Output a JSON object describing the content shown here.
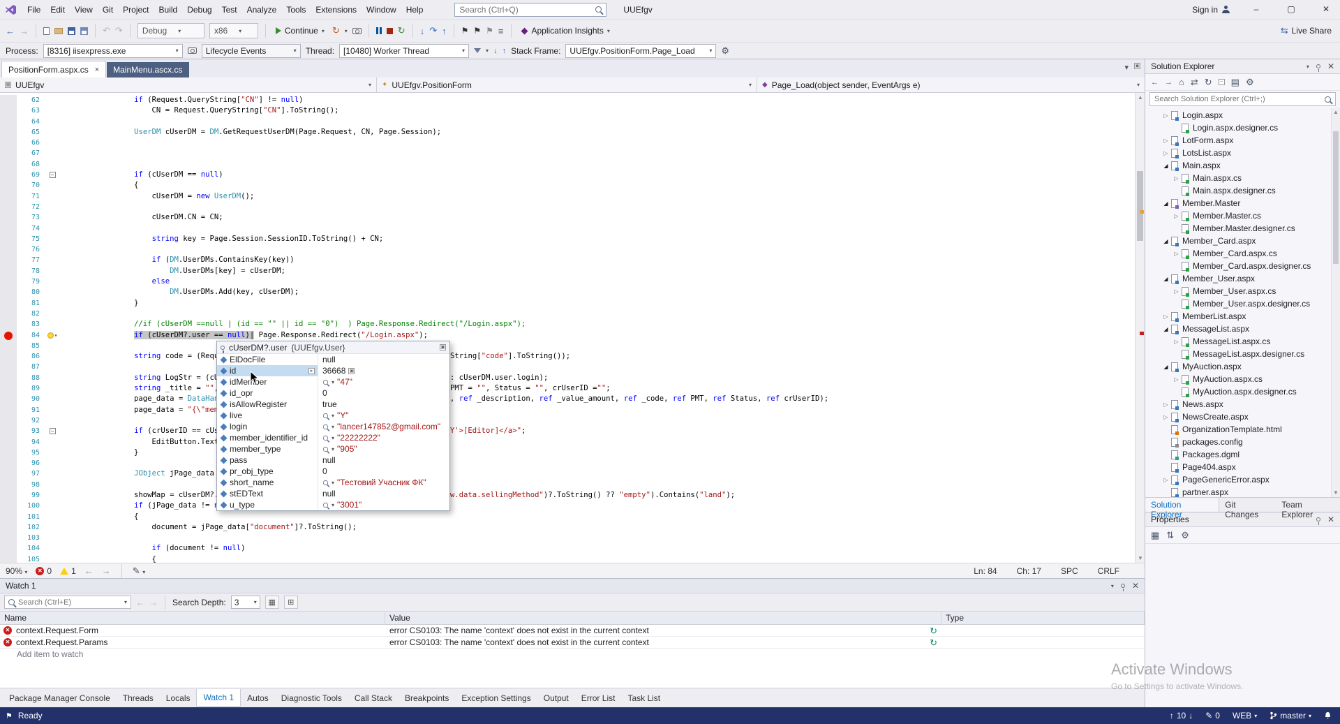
{
  "menu": {
    "items": [
      "File",
      "Edit",
      "View",
      "Git",
      "Project",
      "Build",
      "Debug",
      "Test",
      "Analyze",
      "Tools",
      "Extensions",
      "Window",
      "Help"
    ],
    "search_placeholder": "Search (Ctrl+Q)",
    "solution_name": "UUEfgv",
    "sign_in": "Sign in",
    "window_buttons": {
      "minimize": "–",
      "maximize": "▢",
      "close": "✕"
    }
  },
  "toolbar": {
    "debug_config": "Debug",
    "platform": "x86",
    "continue_label": "Continue",
    "app_insights_label": "Application Insights",
    "live_share_label": "Live Share"
  },
  "debug_location": {
    "process_label": "Process:",
    "process_value": "[8316] iisexpress.exe",
    "lifecycle_label": "Lifecycle Events",
    "thread_label": "Thread:",
    "thread_value": "[10480] Worker Thread",
    "stack_frame_label": "Stack Frame:",
    "stack_frame_value": "UUEfgv.PositionForm.Page_Load"
  },
  "editor": {
    "tabs": [
      {
        "label": "PositionForm.aspx.cs",
        "active": true
      },
      {
        "label": "MainMenu.ascx.cs",
        "active": false
      }
    ],
    "navbar": {
      "project": "UUEfgv",
      "type": "UUEfgv.PositionForm",
      "member": "Page_Load(object sender, EventArgs e)"
    },
    "first_line_number": 62,
    "breakpoint_line": 84,
    "bulb_line": 84,
    "fold_lines": [
      69,
      93
    ],
    "lines": [
      {
        "t": "                if (Request.QueryString[\"CN\"] != null)"
      },
      {
        "t": "                    CN = Request.QueryString[\"CN\"].ToString();"
      },
      {
        "t": ""
      },
      {
        "t": "                UserDM cUserDM = DM.GetRequestUserDM(Page.Request, CN, Page.Session);"
      },
      {
        "t": ""
      },
      {
        "t": ""
      },
      {
        "t": ""
      },
      {
        "t": "                if (cUserDM == null)"
      },
      {
        "t": "                {"
      },
      {
        "t": "                    cUserDM = new UserDM();"
      },
      {
        "t": ""
      },
      {
        "t": "                    cUserDM.CN = CN;"
      },
      {
        "t": ""
      },
      {
        "t": "                    string key = Page.Session.SessionID.ToString() + CN;"
      },
      {
        "t": ""
      },
      {
        "t": "                    if (DM.UserDMs.ContainsKey(key))"
      },
      {
        "t": "                        DM.UserDMs[key] = cUserDM;"
      },
      {
        "t": "                    else"
      },
      {
        "t": "                        DM.UserDMs.Add(key, cUserDM);"
      },
      {
        "t": "                }"
      },
      {
        "t": ""
      },
      {
        "t": "                //if (cUserDM ==null | (id == \"\" || id == \"0\")  ) Page.Response.Redirect(\"/Login.aspx\");"
      },
      {
        "indent": "                ",
        "marked": "if (cUserDM?.user == null)|",
        "rest": " Page.Response.Redirect(\"/Login.aspx\");"
      },
      {
        "t": ""
      },
      {
        "t": "                string code = (Request.QueryString[\"code\"] == null ? \"\" : Request.QueryString[\"code\"].ToString());"
      },
      {
        "t": ""
      },
      {
        "t": "                string LogStr = (cUserDM.user == null ? Request.QueryString.ToString() : cUserDM.user.login);"
      },
      {
        "t": "                string _title = \"\", _description = \"\", _value_amount = \"\", _code = \"\", PMT = \"\", Status = \"\", crUserID =\"\";"
      },
      {
        "t": "                page_data = DataHandler.GetPositionPageData(code.ToString(), ref _title, ref _description, ref _value_amount, ref _code, ref PMT, ref Status, ref crUserID);"
      },
      {
        "t": "                page_data = \"{\\\"members\\\": \\\"\\\"}\";"
      },
      {
        "t": ""
      },
      {
        "t": "                if (crUserID == cUserDM.user.id.ToString()) { EditLink = \"<a href='?&K=Y'>[Editor]</a>\";"
      },
      {
        "t": "                    EditButton.Text = EditLink;"
      },
      {
        "t": "                }"
      },
      {
        "t": ""
      },
      {
        "t": "                JObject jPage_data = JObject.Parse(page_data);"
      },
      {
        "t": ""
      },
      {
        "t": "                showMap = cUserDM?.user == null ? false : ((jPage_data).SelectToken(\"row.data.sellingMethod\")?.ToString() ?? \"empty\").Contains(\"land\");"
      },
      {
        "t": "                if (jPage_data != null)"
      },
      {
        "t": "                {"
      },
      {
        "t": "                    document = jPage_data[\"document\"]?.ToString();"
      },
      {
        "t": ""
      },
      {
        "t": "                    if (document != null)"
      },
      {
        "t": "                    {"
      }
    ],
    "status": {
      "zoom": "90%",
      "errors": "0",
      "warnings": "1",
      "line": "Ln: 84",
      "column": "Ch: 17",
      "spaces": "SPC",
      "eol": "CRLF"
    }
  },
  "datatip": {
    "expr": "cUserDM?.user",
    "value": "{UUEfgv.User}",
    "members": [
      {
        "name": "ElDocFile",
        "value": "null",
        "kind": "plain",
        "selected": false
      },
      {
        "name": "id",
        "value": "36668",
        "kind": "plain",
        "selected": true
      },
      {
        "name": "idMember",
        "value": "\"47\"",
        "kind": "string",
        "selected": false
      },
      {
        "name": "id_opr",
        "value": "0",
        "kind": "plain",
        "selected": false
      },
      {
        "name": "isAllowRegister",
        "value": "true",
        "kind": "plain",
        "selected": false
      },
      {
        "name": "live",
        "value": "\"Y\"",
        "kind": "string",
        "selected": false
      },
      {
        "name": "login",
        "value": "\"lancer147852@gmail.com\"",
        "kind": "string",
        "selected": false
      },
      {
        "name": "member_identifier_id",
        "value": "\"22222222\"",
        "kind": "string",
        "selected": false
      },
      {
        "name": "member_type",
        "value": "\"905\"",
        "kind": "string",
        "selected": false
      },
      {
        "name": "pass",
        "value": "null",
        "kind": "plain",
        "selected": false
      },
      {
        "name": "pr_obj_type",
        "value": "0",
        "kind": "plain",
        "selected": false
      },
      {
        "name": "short_name",
        "value": "\"Тестовий Учасник ФК\"",
        "kind": "string",
        "selected": false
      },
      {
        "name": "stEDText",
        "value": "null",
        "kind": "plain",
        "selected": false
      },
      {
        "name": "u_type",
        "value": "\"3001\"",
        "kind": "string",
        "selected": false
      }
    ]
  },
  "solution_explorer": {
    "title": "Solution Explorer",
    "search_placeholder": "Search Solution Explorer (Ctrl+;)",
    "items": [
      {
        "label": "Login.aspx",
        "indent": 1,
        "arrow": "c",
        "icon": "aspx"
      },
      {
        "label": "Login.aspx.designer.cs",
        "indent": 2,
        "arrow": "n",
        "icon": "cs"
      },
      {
        "label": "LotForm.aspx",
        "indent": 1,
        "arrow": "c",
        "icon": "aspx"
      },
      {
        "label": "LotsList.aspx",
        "indent": 1,
        "arrow": "c",
        "icon": "aspx"
      },
      {
        "label": "Main.aspx",
        "indent": 1,
        "arrow": "e",
        "icon": "aspx"
      },
      {
        "label": "Main.aspx.cs",
        "indent": 2,
        "arrow": "c",
        "icon": "cs"
      },
      {
        "label": "Main.aspx.designer.cs",
        "indent": 2,
        "arrow": "n",
        "icon": "cs"
      },
      {
        "label": "Member.Master",
        "indent": 1,
        "arrow": "e",
        "icon": "master"
      },
      {
        "label": "Member.Master.cs",
        "indent": 2,
        "arrow": "c",
        "icon": "cs"
      },
      {
        "label": "Member.Master.designer.cs",
        "indent": 2,
        "arrow": "n",
        "icon": "cs"
      },
      {
        "label": "Member_Card.aspx",
        "indent": 1,
        "arrow": "e",
        "icon": "aspx"
      },
      {
        "label": "Member_Card.aspx.cs",
        "indent": 2,
        "arrow": "c",
        "icon": "cs"
      },
      {
        "label": "Member_Card.aspx.designer.cs",
        "indent": 2,
        "arrow": "n",
        "icon": "cs"
      },
      {
        "label": "Member_User.aspx",
        "indent": 1,
        "arrow": "e",
        "icon": "aspx"
      },
      {
        "label": "Member_User.aspx.cs",
        "indent": 2,
        "arrow": "c",
        "icon": "cs"
      },
      {
        "label": "Member_User.aspx.designer.cs",
        "indent": 2,
        "arrow": "n",
        "icon": "cs"
      },
      {
        "label": "MemberList.aspx",
        "indent": 1,
        "arrow": "c",
        "icon": "aspx"
      },
      {
        "label": "MessageList.aspx",
        "indent": 1,
        "arrow": "e",
        "icon": "aspx"
      },
      {
        "label": "MessageList.aspx.cs",
        "indent": 2,
        "arrow": "c",
        "icon": "cs"
      },
      {
        "label": "MessageList.aspx.designer.cs",
        "indent": 2,
        "arrow": "n",
        "icon": "cs"
      },
      {
        "label": "MyAuction.aspx",
        "indent": 1,
        "arrow": "e",
        "icon": "aspx"
      },
      {
        "label": "MyAuction.aspx.cs",
        "indent": 2,
        "arrow": "c",
        "icon": "cs"
      },
      {
        "label": "MyAuction.aspx.designer.cs",
        "indent": 2,
        "arrow": "n",
        "icon": "cs"
      },
      {
        "label": "News.aspx",
        "indent": 1,
        "arrow": "c",
        "icon": "aspx"
      },
      {
        "label": "NewsCreate.aspx",
        "indent": 1,
        "arrow": "c",
        "icon": "aspx"
      },
      {
        "label": "OrganizationTemplate.html",
        "indent": 1,
        "arrow": "n",
        "icon": "html"
      },
      {
        "label": "packages.config",
        "indent": 1,
        "arrow": "n",
        "icon": "config"
      },
      {
        "label": "Packages.dgml",
        "indent": 1,
        "arrow": "n",
        "icon": "dgml"
      },
      {
        "label": "Page404.aspx",
        "indent": 1,
        "arrow": "n",
        "icon": "aspx"
      },
      {
        "label": "PageGenericError.aspx",
        "indent": 1,
        "arrow": "c",
        "icon": "aspx"
      },
      {
        "label": "partner.aspx",
        "indent": 1,
        "arrow": "n",
        "icon": "aspx"
      }
    ],
    "tabs": [
      {
        "label": "Solution Explorer",
        "active": true
      },
      {
        "label": "Git Changes",
        "active": false
      },
      {
        "label": "Team Explorer",
        "active": false
      }
    ]
  },
  "properties_panel": {
    "title": "Properties"
  },
  "watch": {
    "title": "Watch 1",
    "search_placeholder": "Search (Ctrl+E)",
    "depth_label": "Search Depth:",
    "depth_value": "3",
    "columns": [
      "Name",
      "Value",
      "Type"
    ],
    "rows": [
      {
        "name": "context.Request.Form",
        "value": "error CS0103: The name 'context' does not exist in the current context"
      },
      {
        "name": "context.Request.Params",
        "value": "error CS0103: The name 'context' does not exist in the current context"
      }
    ],
    "add_hint": "Add item to watch"
  },
  "bottom_tabs": [
    {
      "label": "Package Manager Console",
      "active": false
    },
    {
      "label": "Threads",
      "active": false
    },
    {
      "label": "Locals",
      "active": false
    },
    {
      "label": "Watch 1",
      "active": true
    },
    {
      "label": "Autos",
      "active": false
    },
    {
      "label": "Diagnostic Tools",
      "active": false
    },
    {
      "label": "Call Stack",
      "active": false
    },
    {
      "label": "Breakpoints",
      "active": false
    },
    {
      "label": "Exception Settings",
      "active": false
    },
    {
      "label": "Output",
      "active": false
    },
    {
      "label": "Error List",
      "active": false
    },
    {
      "label": "Task List",
      "active": false
    }
  ],
  "status_bar": {
    "ready": "Ready",
    "up_count": "10",
    "pending_edits": "0",
    "web": "WEB",
    "branch": "master"
  },
  "watermark": {
    "line1": "Activate Windows",
    "line2": "Go to Settings to activate Windows."
  }
}
